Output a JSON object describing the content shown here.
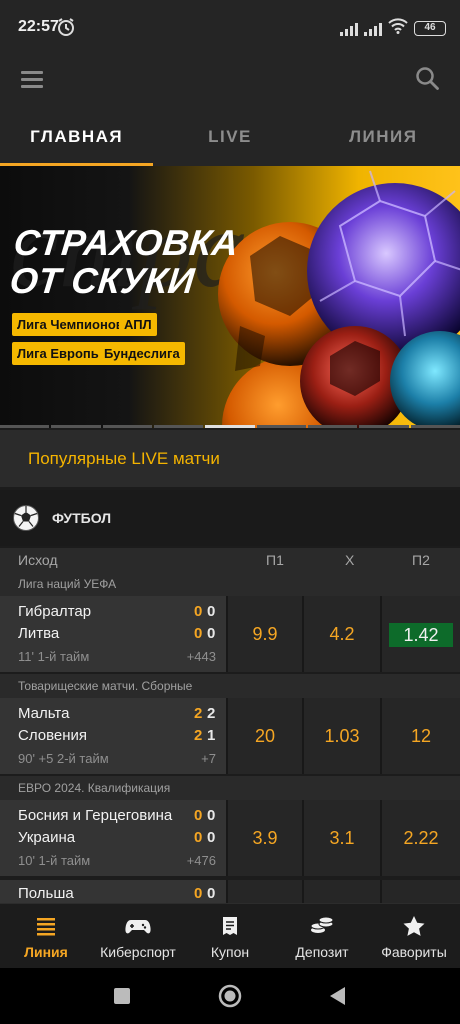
{
  "status_bar": {
    "time": "22:57",
    "battery": "46",
    "icons": [
      "alarm-icon",
      "signal-icon",
      "signal-icon",
      "wifi-icon",
      "battery-icon"
    ]
  },
  "toolbar": {
    "icons": [
      "menu-icon",
      "search-icon"
    ]
  },
  "tabs": [
    {
      "label": "ГЛАВНАЯ",
      "active": true
    },
    {
      "label": "LIVE",
      "active": false
    },
    {
      "label": "ЛИНИЯ",
      "active": false
    }
  ],
  "banner": {
    "title_line1": "СТРАХОВКА",
    "title_line2": "ОТ СКУКИ",
    "tags": [
      "Лига Чемпионов",
      "АПЛ",
      "Лига Европы",
      "Бундеслига"
    ],
    "pages": 9,
    "active_page": 5
  },
  "popular_live": {
    "label": "Популярные LIVE матчи"
  },
  "sport": {
    "name": "ФУТБОЛ",
    "icon": "soccer-ball-icon"
  },
  "columns": {
    "event": "Исход",
    "p1": "П1",
    "x": "Х",
    "p2": "П2"
  },
  "leagues": [
    {
      "name": "Лига наций УЕФА",
      "match": {
        "team1": "Гибралтар",
        "team1_score": "0",
        "team1_set": "0",
        "team2": "Литва",
        "team2_score": "0",
        "team2_set": "0",
        "time": "11' 1-й тайм",
        "more": "+443",
        "p1": "9.9",
        "x": "4.2",
        "p2": "1.42",
        "highlight": "p2"
      }
    },
    {
      "name": "Товарищеские матчи. Сборные",
      "match": {
        "team1": "Мальта",
        "team1_score": "2",
        "team1_set": "2",
        "team2": "Словения",
        "team2_score": "2",
        "team2_set": "1",
        "time": "90' +5 2-й тайм",
        "more": "+7",
        "p1": "20",
        "x": "1.03",
        "p2": "12",
        "highlight": ""
      }
    },
    {
      "name": "ЕВРО 2024. Квалификация",
      "match": {
        "team1": "Босния и Герцеговина",
        "team1_score": "0",
        "team1_set": "0",
        "team2": "Украина",
        "team2_score": "0",
        "team2_set": "0",
        "time": "10' 1-й тайм",
        "more": "+476",
        "p1": "3.9",
        "x": "3.1",
        "p2": "2.22",
        "highlight": ""
      }
    }
  ],
  "partial_match": {
    "team1": "Польша",
    "team1_score": "0",
    "team1_set": "0"
  },
  "bottom_nav": [
    {
      "label": "Линия",
      "icon": "list-icon",
      "active": true
    },
    {
      "label": "Киберспорт",
      "icon": "gamepad-icon",
      "active": false
    },
    {
      "label": "Купон",
      "icon": "coupon-icon",
      "active": false
    },
    {
      "label": "Депозит",
      "icon": "coins-icon",
      "active": false
    },
    {
      "label": "Фавориты",
      "icon": "star-icon",
      "active": false
    }
  ],
  "colors": {
    "accent": "#f5a623",
    "highlight_odd": "#0d6b2a",
    "background": "#1c1c1c"
  }
}
